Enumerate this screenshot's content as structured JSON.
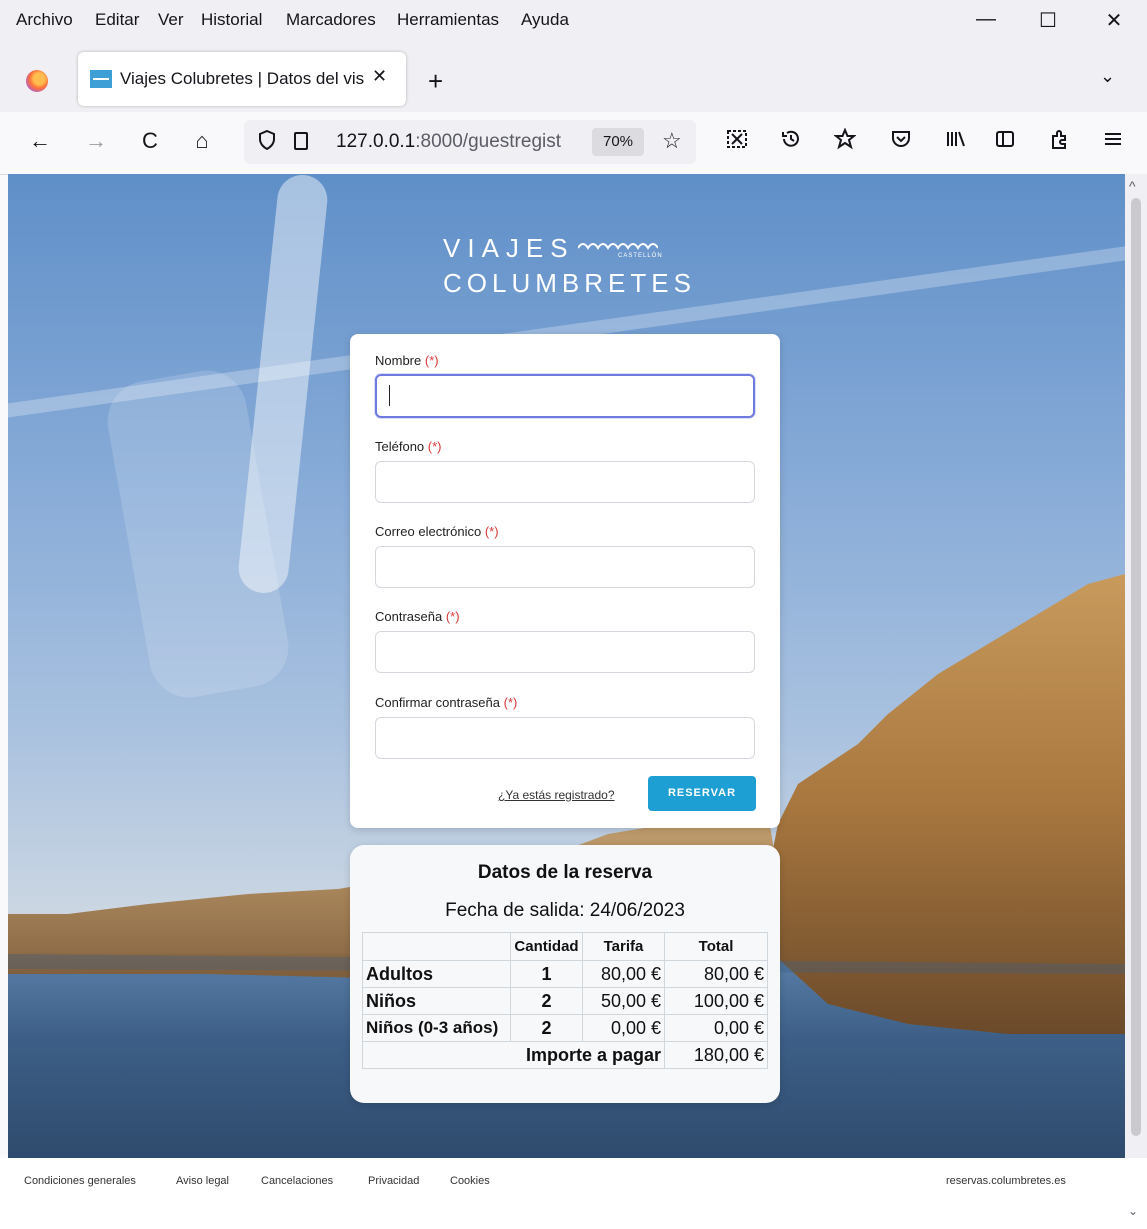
{
  "menubar": {
    "items": [
      "Archivo",
      "Editar",
      "Ver",
      "Historial",
      "Marcadores",
      "Herramientas",
      "Ayuda"
    ]
  },
  "window_controls": {
    "minimize": "—",
    "maximize": "☐",
    "close": "✕"
  },
  "tab": {
    "title": "Viajes Colubretes | Datos del vis",
    "close": "✕"
  },
  "tabbar": {
    "new_tab": "+",
    "list_all": "⌄"
  },
  "navbar": {
    "back": "←",
    "forward": "→",
    "reload": "C",
    "home": "⌂",
    "url_host": "127.0.0.1",
    "url_path": ":8000/guestregist",
    "zoom": "70%",
    "star": "☆"
  },
  "brand": {
    "line1": "VIAJES",
    "line2": "COLUMBRETES",
    "sub": "CASTELLÓN"
  },
  "form": {
    "fields": [
      {
        "label": "Nombre",
        "req": "(*)",
        "value": ""
      },
      {
        "label": "Teléfono",
        "req": "(*)",
        "value": ""
      },
      {
        "label": "Correo electrónico",
        "req": "(*)",
        "value": ""
      },
      {
        "label": "Contraseña",
        "req": "(*)",
        "value": ""
      },
      {
        "label": "Confirmar contraseña",
        "req": "(*)",
        "value": ""
      }
    ],
    "login_link": "¿Ya estás registrado?",
    "submit": "RESERVAR"
  },
  "summary": {
    "title": "Datos de la reserva",
    "date_label": "Fecha de salida: 24/06/2023",
    "headers": [
      "",
      "Cantidad",
      "Tarifa",
      "Total"
    ],
    "rows": [
      {
        "label": "Adultos",
        "qty": "1",
        "rate": "80,00 €",
        "total": "80,00 €"
      },
      {
        "label": "Niños",
        "qty": "2",
        "rate": "50,00 €",
        "total": "100,00 €"
      },
      {
        "label": "Niños (0-3 años)",
        "qty": "2",
        "rate": "0,00 €",
        "total": "0,00 €"
      }
    ],
    "grand_label": "Importe a pagar",
    "grand_total": "180,00 €"
  },
  "footer": {
    "links": [
      "Condiciones generales",
      "Aviso legal",
      "Cancelaciones",
      "Privacidad",
      "Cookies"
    ],
    "domain": "reservas.columbretes.es"
  }
}
